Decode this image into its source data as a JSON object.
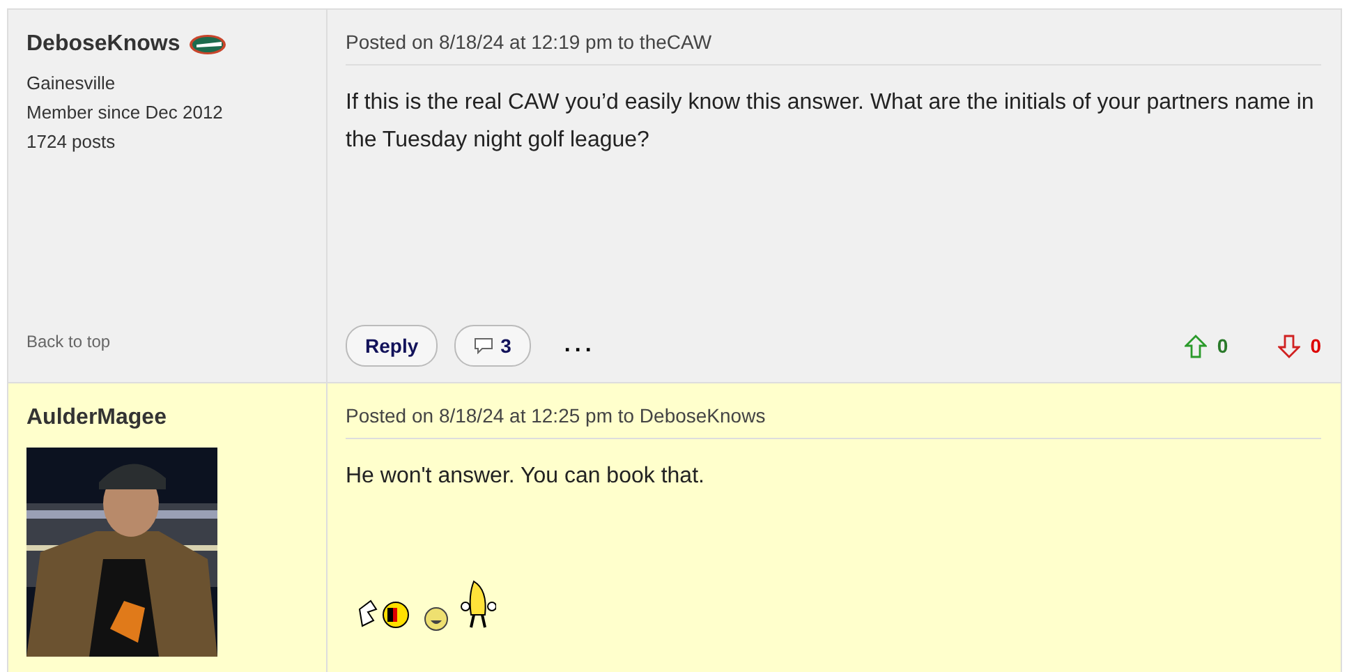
{
  "posts": [
    {
      "author": "DeboseKnows",
      "highlighted": false,
      "location": "Gainesville",
      "member_since": "Member since Dec 2012",
      "post_count": "1724 posts",
      "back_to_top": "Back to top",
      "posted": "Posted on 8/18/24 at 12:19 pm to theCAW",
      "body": "If this is the real CAW you’d easily know this answer. What are the initials of your partners name in the Tuesday night golf league?",
      "actions": {
        "reply": "Reply",
        "comments": "3",
        "more": "...",
        "upvotes": "0",
        "downvotes": "0"
      }
    },
    {
      "author": "AulderMagee",
      "highlighted": true,
      "posted": "Posted on 8/18/24 at 12:25 pm to DeboseKnows",
      "body": "He won't answer. You can book that."
    }
  ]
}
